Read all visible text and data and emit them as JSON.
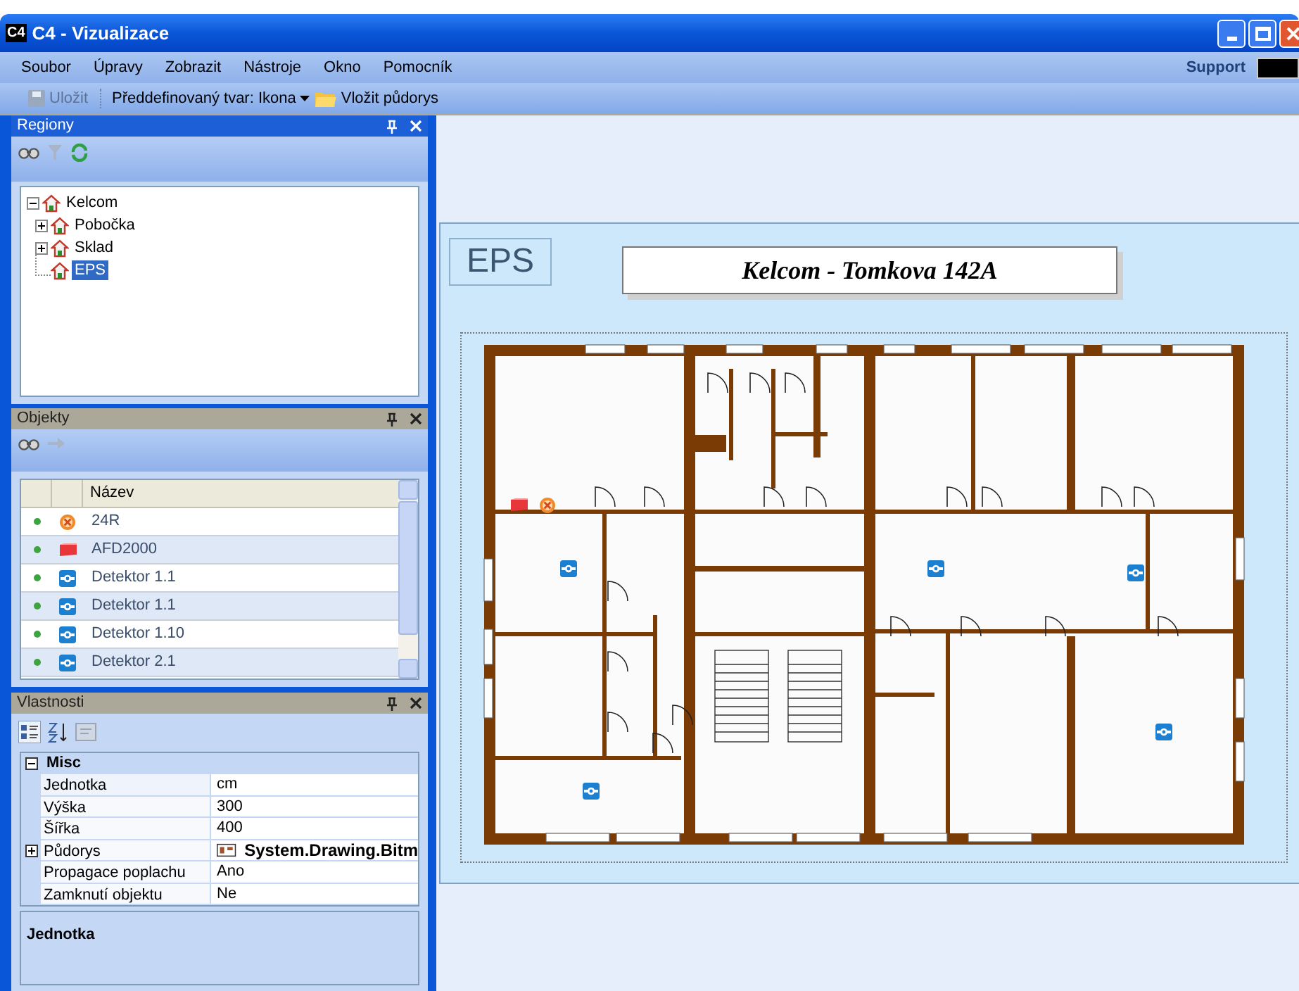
{
  "window": {
    "title": "C4 - Vizualizace",
    "logo": "C4"
  },
  "menu": [
    "Soubor",
    "Úpravy",
    "Zobrazit",
    "Nástroje",
    "Okno",
    "Pomocník"
  ],
  "support": {
    "label": "Support"
  },
  "toolbar": [
    {
      "kind": "save",
      "label": "Uložit",
      "disabled": true
    },
    {
      "kind": "dropdown",
      "label": "Předdefinovaný tvar: Ikona"
    },
    {
      "kind": "folder",
      "label": "Vložit půdorys"
    }
  ],
  "regions_panel": {
    "title": "Regiony",
    "active": true,
    "tree": [
      {
        "label": "Kelcom",
        "expanded": true,
        "selected": false,
        "children": [
          {
            "label": "Pobočka",
            "expanded": false,
            "selected": false
          },
          {
            "label": "Sklad",
            "expanded": false,
            "selected": false
          },
          {
            "label": "EPS",
            "selected": true
          }
        ]
      }
    ]
  },
  "objects_panel": {
    "title": "Objekty",
    "active": false,
    "columns": [
      "Název"
    ],
    "rows": [
      {
        "kind": "siren",
        "name": "24R"
      },
      {
        "kind": "sounder",
        "name": "AFD2000"
      },
      {
        "kind": "detector",
        "name": "Detektor 1.1"
      },
      {
        "kind": "detector",
        "name": "Detektor 1.1"
      },
      {
        "kind": "detector",
        "name": "Detektor 1.10"
      },
      {
        "kind": "detector",
        "name": "Detektor 2.1"
      }
    ]
  },
  "properties_panel": {
    "title": "Vlastnosti",
    "active": false,
    "category": {
      "label": "Misc",
      "expanded": true
    },
    "rows": [
      {
        "name": "Jednotka",
        "value": "cm",
        "kind": "text",
        "expandable": false
      },
      {
        "name": "Výška",
        "value": "300",
        "kind": "text",
        "expandable": false
      },
      {
        "name": "Šířka",
        "value": "400",
        "kind": "text",
        "expandable": false
      },
      {
        "name": "Půdorys",
        "value": "System.Drawing.Bitm",
        "kind": "bitmap",
        "expandable": true
      },
      {
        "name": "Propagace poplachu",
        "value": "Ano",
        "kind": "text",
        "expandable": false
      },
      {
        "name": "Zamknutí objektu",
        "value": "Ne",
        "kind": "text",
        "expandable": false
      }
    ],
    "description": "Jednotka"
  },
  "canvas": {
    "region_label": "EPS",
    "title": "Kelcom - Tomkova 142A",
    "devices": [
      {
        "kind": "sounder"
      },
      {
        "kind": "siren"
      },
      {
        "kind": "detector"
      },
      {
        "kind": "detector"
      },
      {
        "kind": "detector"
      },
      {
        "kind": "detector"
      },
      {
        "kind": "detector"
      }
    ]
  }
}
